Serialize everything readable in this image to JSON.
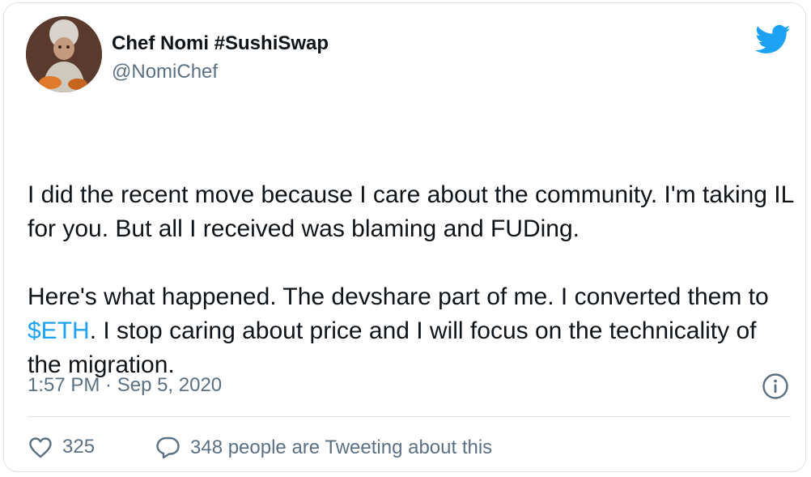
{
  "tweet": {
    "author": {
      "display_name": "Chef Nomi #SushiSwap",
      "handle": "@NomiChef"
    },
    "body": {
      "p1": "I did the recent move because I care about the community. I'm taking IL for you. But all I received was blaming and FUDing.",
      "p2_before": "Here's what happened. The devshare part of me. I converted them to ",
      "p2_cashtag": "$ETH",
      "p2_after": ". I stop caring about price and I will focus on the technicality of the migration."
    },
    "timestamp": "1:57 PM · Sep 5, 2020",
    "likes": "325",
    "tweeting_about": "348 people are Tweeting about this"
  },
  "icons": {
    "brand": "twitter-bird-icon",
    "info": "info-icon",
    "like": "heart-icon",
    "reply": "speech-bubble-icon"
  },
  "colors": {
    "brand": "#1da1f2",
    "text": "#0f1419",
    "secondary": "#5b7083",
    "border": "#dfe3e7"
  }
}
